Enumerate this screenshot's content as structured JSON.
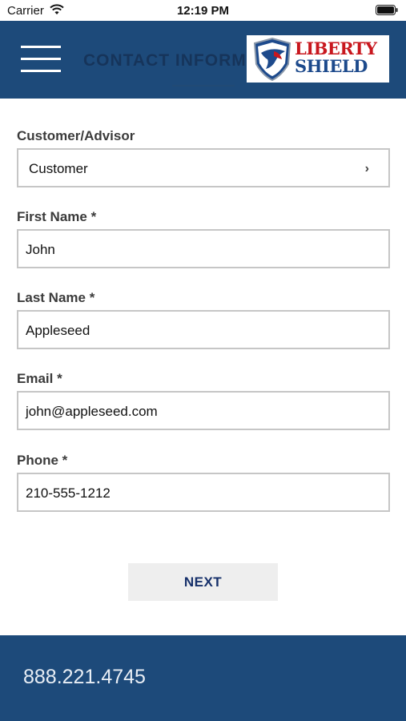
{
  "status_bar": {
    "carrier": "Carrier",
    "time": "12:19 PM"
  },
  "header": {
    "title": "CONTACT INFORMATION",
    "logo_line1": "LIBERTY",
    "logo_line2": "SHIELD",
    "menu_icon": "hamburger-icon"
  },
  "form": {
    "customer_advisor": {
      "label": "Customer/Advisor",
      "value": "Customer"
    },
    "first_name": {
      "label": "First Name *",
      "value": "John"
    },
    "last_name": {
      "label": "Last Name *",
      "value": "Appleseed"
    },
    "email": {
      "label": "Email *",
      "value": "john@appleseed.com"
    },
    "phone": {
      "label": "Phone *",
      "value": "210-555-1212"
    }
  },
  "actions": {
    "next_label": "NEXT"
  },
  "footer": {
    "phone": "888.221.4745"
  },
  "colors": {
    "brand_blue": "#1d4a7a",
    "logo_red": "#c8171e",
    "button_text": "#16306a"
  }
}
